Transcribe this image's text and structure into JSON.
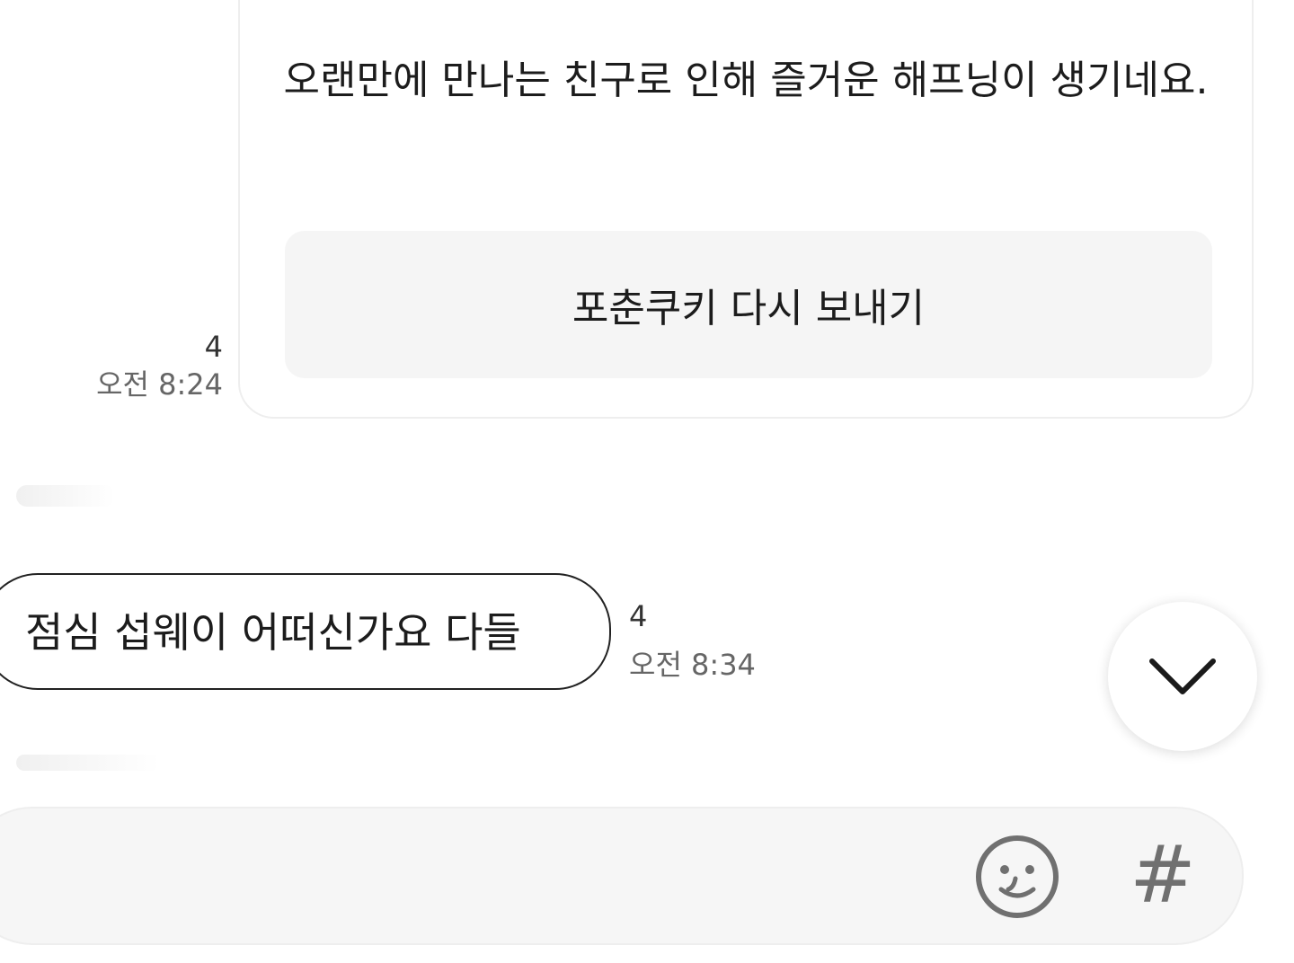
{
  "fortune_card": {
    "message": "오랜만에 만나는 친구로 인해 즐거운 해프닝이 생기네요.",
    "resend_button_label": "포춘쿠키 다시 보내기",
    "unread_count": "4",
    "time": "오전 8:24"
  },
  "incoming_message": {
    "text": "점심 섭웨이 어떠신가요 다들",
    "unread_count": "4",
    "time": "오전 8:34"
  },
  "scroll_button": {
    "icon": "chevron-down-icon"
  },
  "input_bar": {
    "value": "",
    "placeholder": "",
    "emoji_icon": "emoji-icon",
    "hashtag_label": "#"
  },
  "colors": {
    "background": "#ffffff",
    "card_button_bg": "#f5f5f5",
    "input_bg": "#f6f6f6",
    "time_text": "#666666",
    "icon_gray": "#707070"
  }
}
